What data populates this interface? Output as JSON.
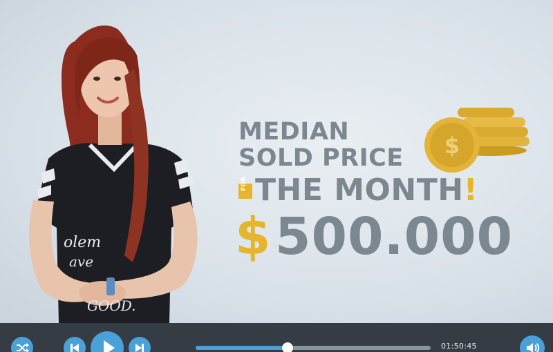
{
  "video": {
    "headline": {
      "line1": "MEDIAN",
      "line2": "SOLD PRICE",
      "for_tag": "FOR",
      "month": "THE MONTH",
      "exclaim": "!",
      "currency": "$",
      "amount": "500.000"
    },
    "coin_symbol": "$",
    "shirt_text": [
      "olem",
      "ave",
      "GOOD."
    ]
  },
  "player": {
    "time": "01:50:45",
    "progress_fraction": 0.39,
    "icons": {
      "shuffle": "shuffle-icon",
      "previous": "skip-previous-icon",
      "play": "play-icon",
      "next": "skip-next-icon",
      "volume": "volume-icon"
    }
  },
  "colors": {
    "accent": "#4aa0d8",
    "gold": "#e6b52e",
    "headline_gray": "#7d8790",
    "control_bar": "#353c44"
  }
}
